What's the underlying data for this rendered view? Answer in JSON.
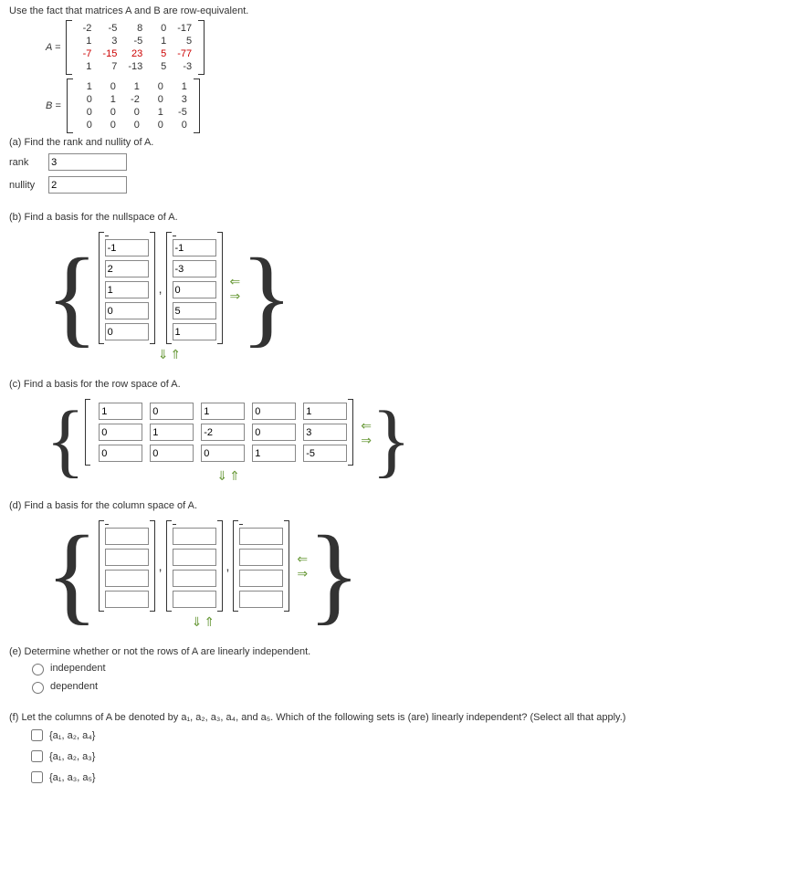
{
  "intro": "Use the fact that matrices A and B are row-equivalent.",
  "matrixA_label": "A =",
  "matrixB_label": "B =",
  "matrixA": [
    [
      "-2",
      "-5",
      "8",
      "0",
      "-17"
    ],
    [
      "1",
      "3",
      "-5",
      "1",
      "5"
    ],
    [
      "-7",
      "-15",
      "23",
      "5",
      "-77"
    ],
    [
      "1",
      "7",
      "-13",
      "5",
      "-3"
    ]
  ],
  "matrixB": [
    [
      "1",
      "0",
      "1",
      "0",
      "1"
    ],
    [
      "0",
      "1",
      "-2",
      "0",
      "3"
    ],
    [
      "0",
      "0",
      "0",
      "1",
      "-5"
    ],
    [
      "0",
      "0",
      "0",
      "0",
      "0"
    ]
  ],
  "a": {
    "prompt": "(a) Find the rank and nullity of A.",
    "rank_label": "rank",
    "rank_val": "3",
    "nullity_label": "nullity",
    "nullity_val": "2"
  },
  "b": {
    "prompt": "(b) Find a basis for the nullspace of A.",
    "vec1": [
      "-1",
      "2",
      "1",
      "0",
      "0"
    ],
    "vec2": [
      "-1",
      "-3",
      "0",
      "5",
      "1"
    ]
  },
  "c": {
    "prompt": "(c) Find a basis for the row space of A.",
    "rows": [
      [
        "1",
        "0",
        "1",
        "0",
        "1"
      ],
      [
        "0",
        "1",
        "-2",
        "0",
        "3"
      ],
      [
        "0",
        "0",
        "0",
        "1",
        "-5"
      ]
    ]
  },
  "d": {
    "prompt": "(d) Find a basis for the column space of A.",
    "vecs": [
      [
        "",
        "",
        "",
        ""
      ],
      [
        "",
        "",
        "",
        ""
      ],
      [
        "",
        "",
        "",
        ""
      ]
    ]
  },
  "e": {
    "prompt": "(e) Determine whether or not the rows of A are linearly independent.",
    "opt1": "independent",
    "opt2": "dependent"
  },
  "f": {
    "prompt": "(f) Let the columns of A be denoted by a₁, a₂, a₃, a₄, and a₅. Which of the following sets is (are) linearly independent? (Select all that apply.)",
    "opt1": "{a₁, a₂, a₄}",
    "opt2": "{a₁, a₂, a₃}",
    "opt3": "{a₁, a₃, a₅}"
  },
  "chart_data": {
    "type": "table",
    "note": "matrices A (row 3 highlighted red) and B, plus answer inputs",
    "A": [
      [
        -2,
        -5,
        8,
        0,
        -17
      ],
      [
        1,
        3,
        -5,
        1,
        5
      ],
      [
        -7,
        -15,
        23,
        5,
        -77
      ],
      [
        1,
        7,
        -13,
        5,
        -3
      ]
    ],
    "B": [
      [
        1,
        0,
        1,
        0,
        1
      ],
      [
        0,
        1,
        -2,
        0,
        3
      ],
      [
        0,
        0,
        0,
        1,
        -5
      ],
      [
        0,
        0,
        0,
        0,
        0
      ]
    ]
  }
}
